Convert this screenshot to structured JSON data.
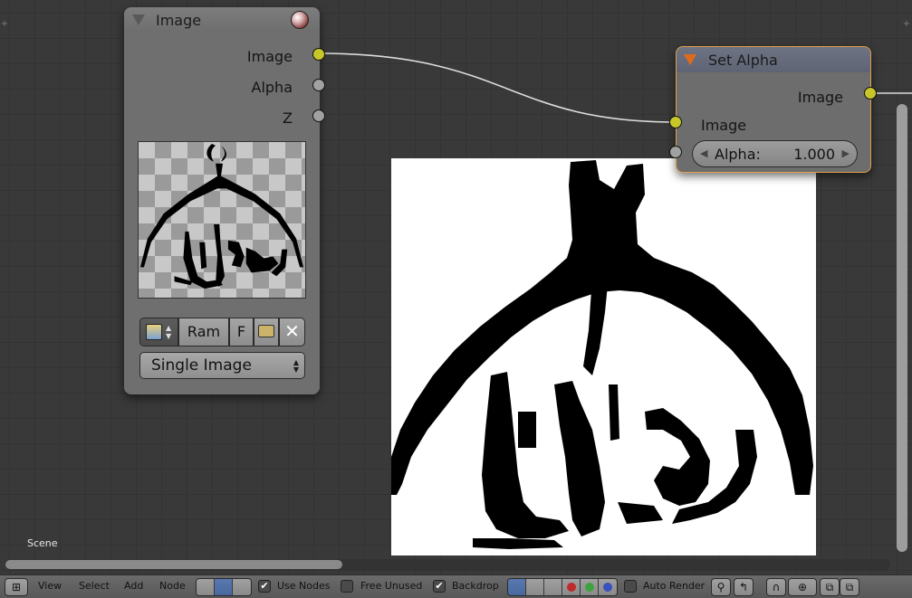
{
  "image_node": {
    "title": "Image",
    "outputs": [
      {
        "label": "Image",
        "color": "yellow"
      },
      {
        "label": "Alpha",
        "color": "gray"
      },
      {
        "label": "Z",
        "color": "gray"
      }
    ],
    "ram_label": "Ram",
    "f_label": "F",
    "source_select": "Single Image",
    "close_glyph": "✕"
  },
  "setalpha_node": {
    "title": "Set Alpha",
    "output_label": "Image",
    "input_label": "Image",
    "alpha_label": "Alpha:",
    "alpha_value": "1.000"
  },
  "scene_label": "Scene",
  "header": {
    "menu": [
      "View",
      "Select",
      "Add",
      "Node"
    ],
    "use_nodes_label": "Use Nodes",
    "use_nodes_checked": "✔",
    "free_unused_label": "Free Unused",
    "backdrop_label": "Backdrop",
    "backdrop_checked": "✔",
    "auto_render_label": "Auto Render"
  },
  "colors": {
    "yellow_socket": "#c7c729",
    "gray_socket": "#a1a1a1",
    "active_node_outline": "#e0a050",
    "orange_arrow": "#e06a1c"
  }
}
